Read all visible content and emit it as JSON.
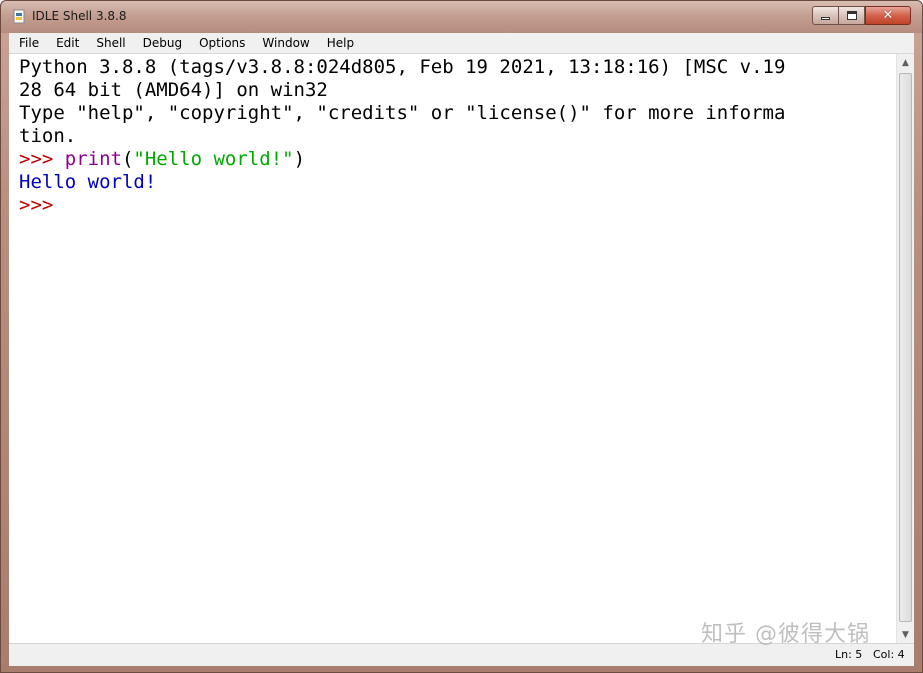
{
  "window": {
    "title": "IDLE Shell 3.8.8",
    "icon": "python-idle-icon",
    "controls": {
      "minimize": "minimize-icon",
      "maximize": "maximize-icon",
      "close": "close-icon"
    }
  },
  "menubar": {
    "items": [
      "File",
      "Edit",
      "Shell",
      "Debug",
      "Options",
      "Window",
      "Help"
    ]
  },
  "shell": {
    "banner_line1": "Python 3.8.8 (tags/v3.8.8:024d805, Feb 19 2021, 13:18:16) [MSC v.19",
    "banner_line2": "28 64 bit (AMD64)] on win32",
    "banner_line3": "Type \"help\", \"copyright\", \"credits\" or \"license()\" for more informa",
    "banner_line4": "tion.",
    "prompt1": ">>> ",
    "cmd_builtin": "print",
    "cmd_open": "(",
    "cmd_string": "\"Hello world!\"",
    "cmd_close": ")",
    "output": "Hello world!",
    "prompt2": ">>>"
  },
  "statusbar": {
    "ln": "Ln: 5",
    "col": "Col: 4"
  },
  "watermark": "知乎 @彼得大锅",
  "colors": {
    "prompt": "#c00000",
    "builtin": "#900090",
    "string": "#00aa00",
    "stdout": "#0000c0"
  }
}
